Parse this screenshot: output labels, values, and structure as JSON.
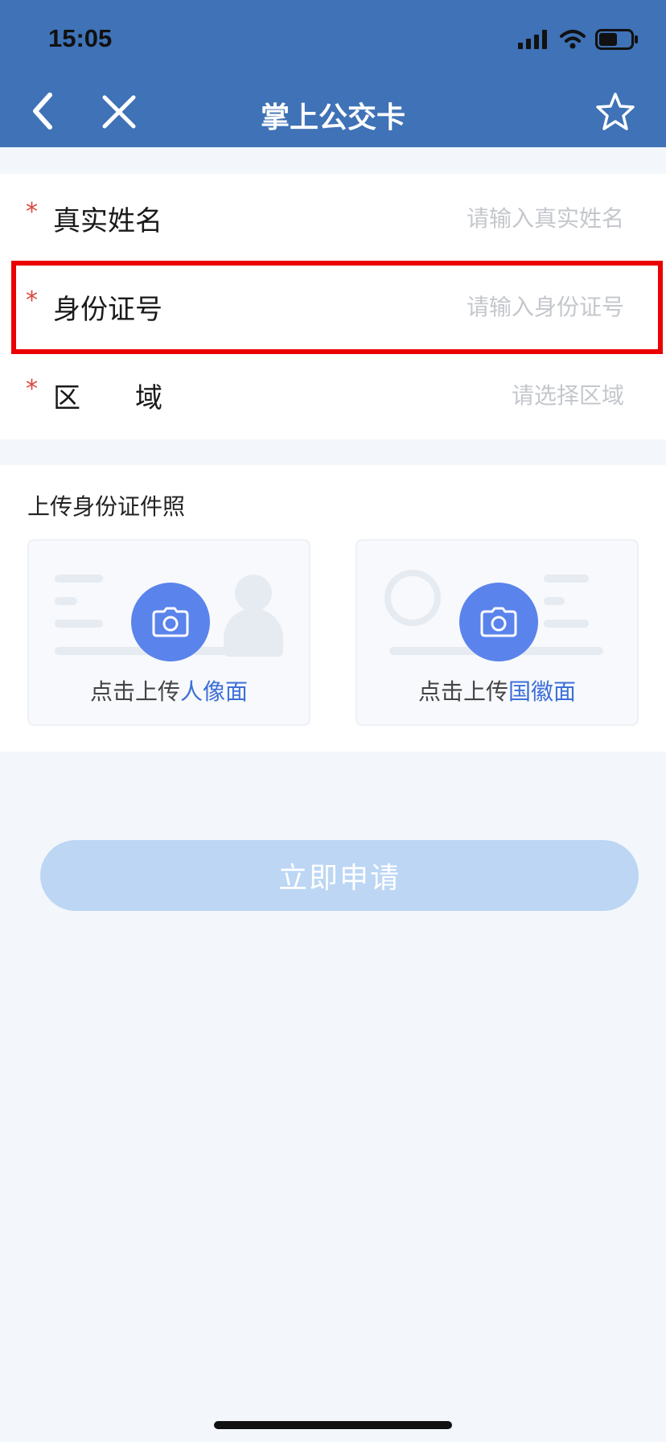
{
  "status_bar": {
    "time": "15:05",
    "icons": [
      "signal-icon",
      "wifi-icon",
      "battery-icon"
    ]
  },
  "nav": {
    "title": "掌上公交卡",
    "back_icon": "chevron-left-icon",
    "close_icon": "close-icon",
    "favorite_icon": "star-icon"
  },
  "form": {
    "required_mark": "*",
    "fields": [
      {
        "label": "真实姓名",
        "placeholder": "请输入真实姓名",
        "value": ""
      },
      {
        "label": "身份证号",
        "placeholder": "请输入身份证号",
        "value": ""
      },
      {
        "label": "区　　域",
        "placeholder": "请选择区域",
        "value": ""
      }
    ]
  },
  "upload": {
    "title": "上传身份证件照",
    "front": {
      "prefix": "点击上传",
      "highlight": "人像面",
      "icon": "camera-icon"
    },
    "back": {
      "prefix": "点击上传",
      "highlight": "国徽面",
      "icon": "camera-icon"
    }
  },
  "submit": {
    "label": "立即申请"
  },
  "colors": {
    "header": "#3f72b6",
    "accent": "#5b83ec",
    "required": "#d9463d",
    "highlight_box": "#ea0000",
    "button_disabled": "#bcd6f4"
  }
}
